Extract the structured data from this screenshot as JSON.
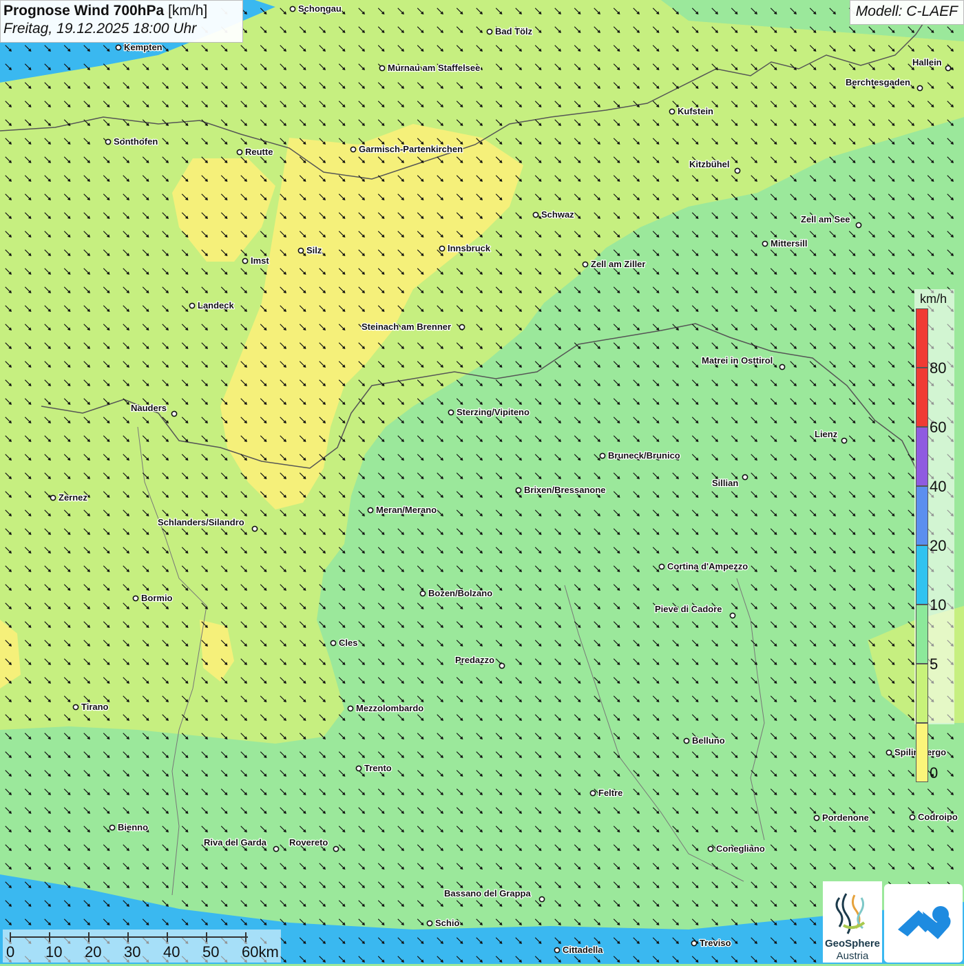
{
  "header": {
    "title_bold": "Prognose Wind 700hPa",
    "title_unit": "[km/h]",
    "subtitle": "Freitag, 19.12.2025 18:00 Uhr"
  },
  "model": {
    "label": "Modell: C-LAEF"
  },
  "legend": {
    "unit": "km/h",
    "bands": [
      {
        "label": "80",
        "color": "#f03b34"
      },
      {
        "label": "60",
        "color": "#8f5be0"
      },
      {
        "label": "40",
        "color": "#5b8fef"
      },
      {
        "label": "20",
        "color": "#30c3f0"
      },
      {
        "label": "10",
        "color": "#8ce99a"
      },
      {
        "label": "5",
        "color": "#c8f27a"
      },
      {
        "label": "0",
        "color": "#fbf57a"
      }
    ],
    "top_color": "#f03b34"
  },
  "scalebar": {
    "labels": [
      "0",
      "10",
      "20",
      "30",
      "40",
      "50",
      "60km"
    ]
  },
  "logos": {
    "org_name_1": "GeoSphere",
    "org_name_2": "Austria"
  },
  "colors": {
    "water": "#3ab8f0",
    "wind_0_5": "#f5f07a",
    "wind_5_10": "#c6ef80",
    "wind_10_20": "#9be89b",
    "border": "#555555"
  },
  "wind": {
    "direction_deg_to": 135,
    "note_arrows": "uniform field of wind arrows pointing to south-east"
  },
  "places": [
    {
      "name": "Schongau"
    },
    {
      "name": "Bad Tölz"
    },
    {
      "name": "Kempten"
    },
    {
      "name": "Murnau am Staffelsee"
    },
    {
      "name": "Hallein"
    },
    {
      "name": "Berchtesgaden"
    },
    {
      "name": "Kufstein"
    },
    {
      "name": "Sonthofen"
    },
    {
      "name": "Reutte"
    },
    {
      "name": "Garmisch-Partenkirchen"
    },
    {
      "name": "Kitzbühel"
    },
    {
      "name": "Schwaz"
    },
    {
      "name": "Zell am See"
    },
    {
      "name": "Mittersill"
    },
    {
      "name": "Silz"
    },
    {
      "name": "Innsbruck"
    },
    {
      "name": "Imst"
    },
    {
      "name": "Zell am Ziller"
    },
    {
      "name": "Landeck"
    },
    {
      "name": "Steinach am Brenner"
    },
    {
      "name": "Matrei in Osttirol"
    },
    {
      "name": "Nauders"
    },
    {
      "name": "Sterzing/Vipiteno"
    },
    {
      "name": "Lienz"
    },
    {
      "name": "Bruneck/Brunico"
    },
    {
      "name": "Sillian"
    },
    {
      "name": "Zernez"
    },
    {
      "name": "Brixen/Bressanone"
    },
    {
      "name": "Meran/Merano"
    },
    {
      "name": "Schlanders/Silandro"
    },
    {
      "name": "Cortina d'Ampezzo"
    },
    {
      "name": "Bozen/Bolzano"
    },
    {
      "name": "Bormio"
    },
    {
      "name": "Pieve di Cadore"
    },
    {
      "name": "Cles"
    },
    {
      "name": "Predazzo"
    },
    {
      "name": "Tirano"
    },
    {
      "name": "Mezzolombardo"
    },
    {
      "name": "Belluno"
    },
    {
      "name": "Spilimbergo"
    },
    {
      "name": "Trento"
    },
    {
      "name": "Feltre"
    },
    {
      "name": "Bienno"
    },
    {
      "name": "Pordenone"
    },
    {
      "name": "Codroipo"
    },
    {
      "name": "Riva del Garda"
    },
    {
      "name": "Rovereto"
    },
    {
      "name": "Conegliano"
    },
    {
      "name": "Bassano del Grappa"
    },
    {
      "name": "Schio"
    },
    {
      "name": "Treviso"
    },
    {
      "name": "Cittadella"
    }
  ]
}
